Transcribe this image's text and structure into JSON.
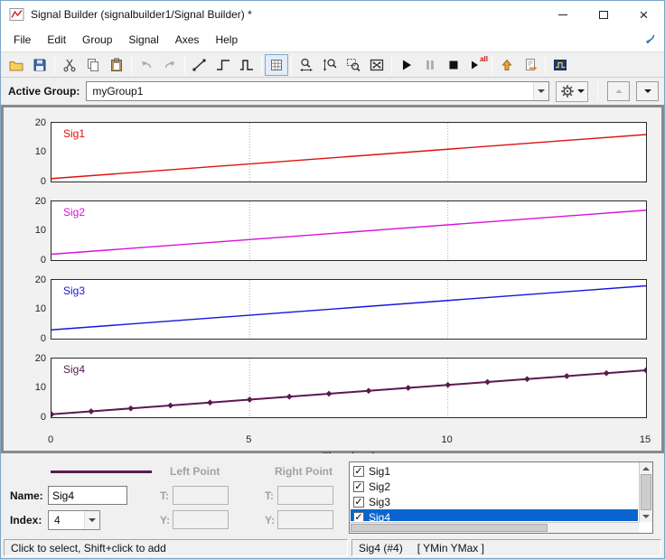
{
  "window": {
    "title": "Signal Builder (signalbuilder1/Signal Builder) *",
    "controls": [
      "minimize",
      "maximize",
      "close"
    ]
  },
  "menu": {
    "items": [
      "File",
      "Edit",
      "Group",
      "Signal",
      "Axes",
      "Help"
    ]
  },
  "toolbar": {
    "run_all_label": "all",
    "buttons": [
      {
        "name": "open"
      },
      {
        "name": "save"
      },
      {
        "name": "cut"
      },
      {
        "name": "copy"
      },
      {
        "name": "paste"
      },
      {
        "name": "undo",
        "disabled": true
      },
      {
        "name": "redo",
        "disabled": true
      },
      {
        "name": "draw-line"
      },
      {
        "name": "draw-step"
      },
      {
        "name": "draw-pulse"
      },
      {
        "name": "snap-grid",
        "pressed": true
      },
      {
        "name": "zoom-time"
      },
      {
        "name": "zoom-y"
      },
      {
        "name": "zoom-region"
      },
      {
        "name": "zoom-fit"
      },
      {
        "name": "run"
      },
      {
        "name": "pause",
        "disabled": true
      },
      {
        "name": "stop"
      },
      {
        "name": "run-all"
      },
      {
        "name": "up"
      },
      {
        "name": "export"
      },
      {
        "name": "scope"
      }
    ]
  },
  "active_group": {
    "label": "Active Group:",
    "value": "myGroup1"
  },
  "plots": {
    "xlabel": "Time (sec)",
    "xticks": [
      0,
      5,
      10,
      15
    ],
    "grid_x": [
      5,
      10
    ],
    "yticks": [
      0,
      10,
      20
    ]
  },
  "chart_data": [
    {
      "type": "line",
      "name": "Sig1",
      "color": "#dd1111",
      "line_width": 1.4,
      "x": [
        0,
        15
      ],
      "y": [
        1,
        16
      ],
      "xlim": [
        0,
        15
      ],
      "ylim": [
        0,
        20
      ],
      "yticks": [
        0,
        10,
        20
      ],
      "grid_x": [
        5,
        10
      ]
    },
    {
      "type": "line",
      "name": "Sig2",
      "color": "#d812d8",
      "line_width": 1.4,
      "x": [
        0,
        15
      ],
      "y": [
        2,
        17
      ],
      "xlim": [
        0,
        15
      ],
      "ylim": [
        0,
        20
      ],
      "yticks": [
        0,
        10,
        20
      ],
      "grid_x": [
        5,
        10
      ]
    },
    {
      "type": "line",
      "name": "Sig3",
      "color": "#1515dd",
      "line_width": 1.4,
      "x": [
        0,
        15
      ],
      "y": [
        3,
        18
      ],
      "xlim": [
        0,
        15
      ],
      "ylim": [
        0,
        20
      ],
      "yticks": [
        0,
        10,
        20
      ],
      "grid_x": [
        5,
        10
      ]
    },
    {
      "type": "line",
      "name": "Sig4",
      "color": "#5a1950",
      "line_width": 2,
      "markers": "diamond",
      "x": [
        0,
        1,
        2,
        3,
        4,
        5,
        6,
        7,
        8,
        9,
        10,
        11,
        12,
        13,
        14,
        15
      ],
      "y": [
        1,
        2,
        3,
        4,
        5,
        6,
        7,
        8,
        9,
        10,
        11,
        12,
        13,
        14,
        15,
        16
      ],
      "xlim": [
        0,
        15
      ],
      "ylim": [
        0,
        20
      ],
      "yticks": [
        0,
        10,
        20
      ],
      "grid_x": [
        5,
        10
      ]
    }
  ],
  "editor": {
    "selected_color": "#5a1950",
    "left_point_label": "Left Point",
    "right_point_label": "Right Point",
    "name_label": "Name:",
    "name_value": "Sig4",
    "index_label": "Index:",
    "index_value": "4",
    "t_label": "T:",
    "y_label": "Y:",
    "left_point": {
      "t": "",
      "y": ""
    },
    "right_point": {
      "t": "",
      "y": ""
    },
    "signals": [
      {
        "label": "Sig1",
        "checked": true,
        "selected": false
      },
      {
        "label": "Sig2",
        "checked": true,
        "selected": false
      },
      {
        "label": "Sig3",
        "checked": true,
        "selected": false
      },
      {
        "label": "Sig4",
        "checked": true,
        "selected": true
      }
    ]
  },
  "status": {
    "left": "Click to select, Shift+click to add",
    "right_signal": "Sig4 (#4)",
    "right_range": "[ YMin YMax ]"
  }
}
